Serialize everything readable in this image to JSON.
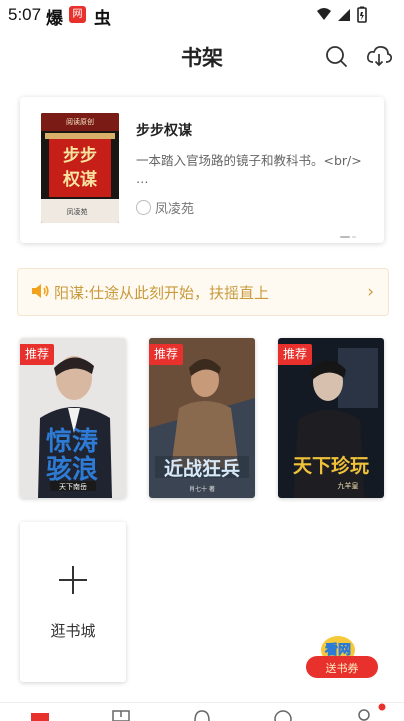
{
  "status_bar": {
    "time": "5:07",
    "app_icon_1": "爆",
    "app_icon_2": "网",
    "app_icon_3": "虫"
  },
  "header": {
    "title": "书架",
    "search_icon": "search-icon",
    "download_icon": "cloud-download-icon"
  },
  "featured_book": {
    "title": "步步权谋",
    "description": "一本踏入官场路的镜子和教科书。<br/> …",
    "author": "凤凌苑",
    "cover": {
      "publisher": "阅读原创",
      "title_line1": "步步",
      "title_line2": "权谋",
      "author": "凤凌苑"
    }
  },
  "notice": {
    "icon": "speaker-icon",
    "text": "阳谋:仕途从此刻开始，扶摇直上"
  },
  "shelf": [
    {
      "badge": "推荐",
      "cover_title_line1": "惊涛",
      "cover_title_line2": "骇浪",
      "cover_sub": "天下南岳"
    },
    {
      "badge": "推荐",
      "cover_title": "近战狂兵",
      "cover_sub": "肖七十 著"
    },
    {
      "badge": "推荐",
      "cover_title": "天下珍玩",
      "cover_sub": "九羊皇"
    }
  ],
  "add_tile": {
    "label": "逛书城"
  },
  "coupon": {
    "line1": "看网",
    "line2": "送书券"
  },
  "colors": {
    "accent": "#e8302c",
    "notice_text": "#c99a3c",
    "notice_bg": "#fffaf1"
  }
}
